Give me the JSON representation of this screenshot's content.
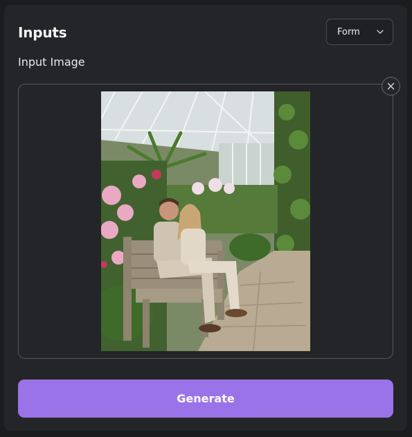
{
  "panel": {
    "title": "Inputs",
    "mode_select": {
      "value": "Form",
      "icon": "chevron-down-icon"
    }
  },
  "input_image": {
    "label": "Input Image",
    "remove_icon": "close-icon",
    "image_subject": "couple-on-bench-in-greenhouse"
  },
  "actions": {
    "generate_label": "Generate"
  },
  "colors": {
    "background": "#1b1c1e",
    "panel": "#242528",
    "accent": "#9b73e8",
    "border": "#57585d"
  }
}
